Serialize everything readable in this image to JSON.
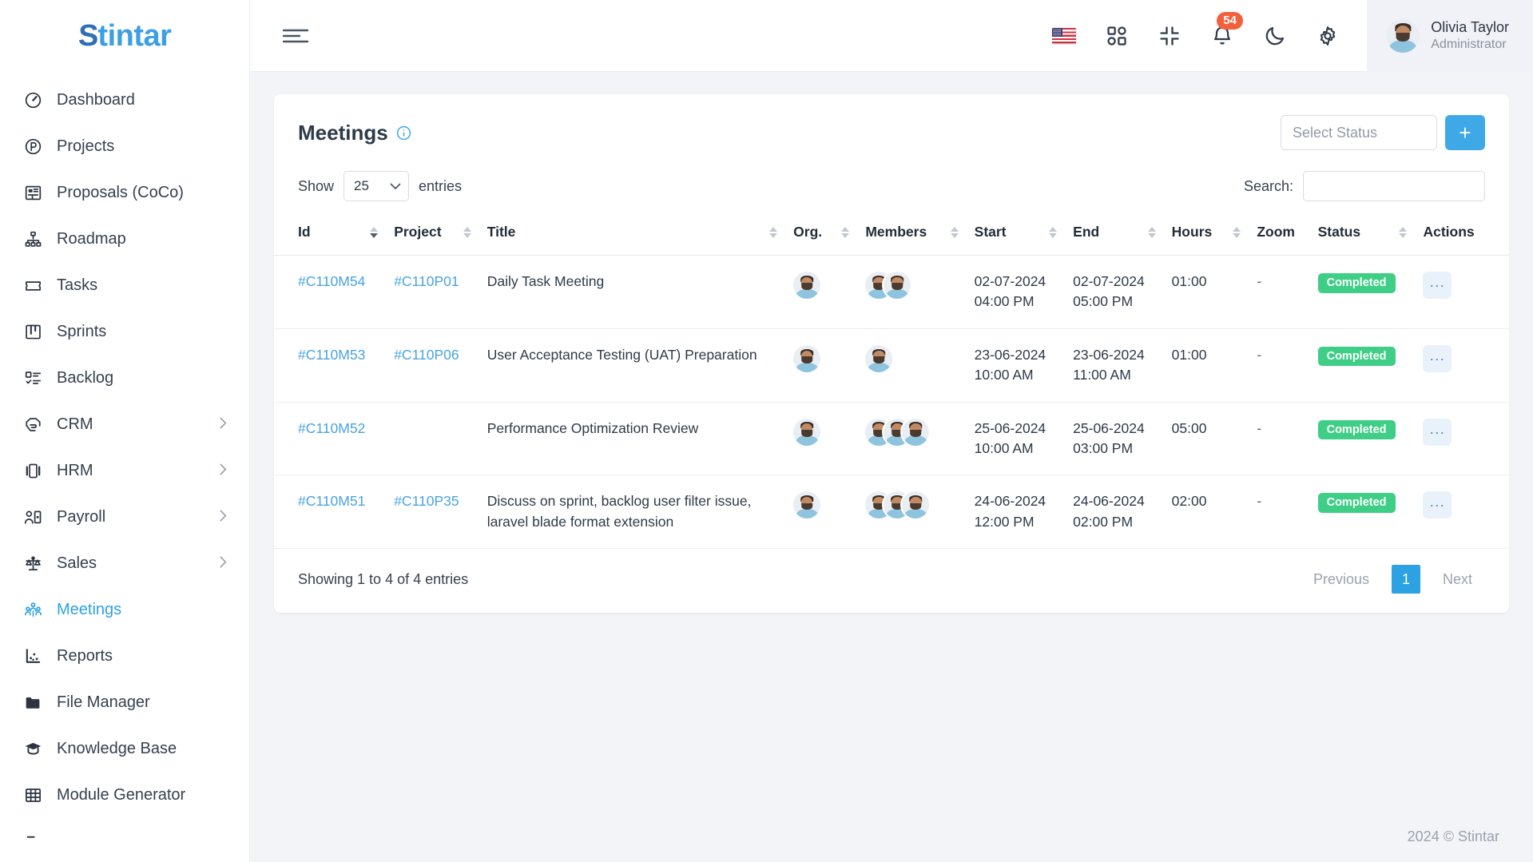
{
  "brand": {
    "name": "Stintar",
    "initial": "S",
    "rest": "tintar"
  },
  "sidebar": {
    "items": [
      {
        "label": "Dashboard",
        "icon": "gauge-icon",
        "active": false,
        "chevron": false
      },
      {
        "label": "Projects",
        "icon": "circle-p-icon",
        "active": false,
        "chevron": false
      },
      {
        "label": "Proposals (CoCo)",
        "icon": "layout-panel-icon",
        "active": false,
        "chevron": false
      },
      {
        "label": "Roadmap",
        "icon": "sitemap-icon",
        "active": false,
        "chevron": false
      },
      {
        "label": "Tasks",
        "icon": "ticket-icon",
        "active": false,
        "chevron": false
      },
      {
        "label": "Sprints",
        "icon": "kanban-icon",
        "active": false,
        "chevron": false
      },
      {
        "label": "Backlog",
        "icon": "checklist-icon",
        "active": false,
        "chevron": false
      },
      {
        "label": "CRM",
        "icon": "handshake-icon",
        "active": false,
        "chevron": true
      },
      {
        "label": "HRM",
        "icon": "id-card-icon",
        "active": false,
        "chevron": true
      },
      {
        "label": "Payroll",
        "icon": "user-money-icon",
        "active": false,
        "chevron": true
      },
      {
        "label": "Sales",
        "icon": "scales-icon",
        "active": false,
        "chevron": true
      },
      {
        "label": "Meetings",
        "icon": "people-group-icon",
        "active": true,
        "chevron": false
      },
      {
        "label": "Reports",
        "icon": "scatter-chart-icon",
        "active": false,
        "chevron": false
      },
      {
        "label": "File Manager",
        "icon": "folder-icon",
        "active": false,
        "chevron": false
      },
      {
        "label": "Knowledge Base",
        "icon": "graduation-cap-icon",
        "active": false,
        "chevron": false
      },
      {
        "label": "Module Generator",
        "icon": "grid-table-icon",
        "active": false,
        "chevron": false
      }
    ]
  },
  "topbar": {
    "menu_toggle": "hamburger-icon",
    "language_flag": "us-flag-icon",
    "apps": "apps-grid-icon",
    "fullscreen": "compress-icon",
    "notifications": "bell-icon",
    "notification_count": "54",
    "theme": "moon-icon",
    "settings": "gear-icon",
    "user": {
      "name": "Olivia Taylor",
      "role": "Administrator"
    }
  },
  "card": {
    "title": "Meetings",
    "info_icon": "info-circle-icon",
    "status_filter_placeholder": "Select Status",
    "add_label": "+"
  },
  "tools": {
    "show_label": "Show",
    "entries_label": "entries",
    "page_length": "25",
    "search_label": "Search:",
    "search_value": "",
    "search_placeholder": ""
  },
  "table": {
    "columns": [
      {
        "label": "Id",
        "sortable": true,
        "sort": "desc"
      },
      {
        "label": "Project",
        "sortable": true,
        "sort": "none"
      },
      {
        "label": "Title",
        "sortable": true,
        "sort": "none"
      },
      {
        "label": "Org.",
        "sortable": true,
        "sort": "none"
      },
      {
        "label": "Members",
        "sortable": true,
        "sort": "none"
      },
      {
        "label": "Start",
        "sortable": true,
        "sort": "none"
      },
      {
        "label": "End",
        "sortable": true,
        "sort": "none"
      },
      {
        "label": "Hours",
        "sortable": true,
        "sort": "none"
      },
      {
        "label": "Zoom",
        "sortable": false,
        "sort": "none"
      },
      {
        "label": "Status",
        "sortable": true,
        "sort": "none"
      },
      {
        "label": "Actions",
        "sortable": false,
        "sort": "none"
      }
    ],
    "rows": [
      {
        "id": "#C110M54",
        "project": "#C110P01",
        "title": "Daily Task Meeting",
        "org_count": 1,
        "member_count": 2,
        "start_date": "02-07-2024",
        "start_time": "04:00 PM",
        "end_date": "02-07-2024",
        "end_time": "05:00 PM",
        "hours": "01:00",
        "zoom": "-",
        "status": "Completed",
        "action": "..."
      },
      {
        "id": "#C110M53",
        "project": "#C110P06",
        "title": "User Acceptance Testing (UAT) Preparation",
        "org_count": 1,
        "member_count": 1,
        "start_date": "23-06-2024",
        "start_time": "10:00 AM",
        "end_date": "23-06-2024",
        "end_time": "11:00 AM",
        "hours": "01:00",
        "zoom": "-",
        "status": "Completed",
        "action": "..."
      },
      {
        "id": "#C110M52",
        "project": "",
        "title": "Performance Optimization Review",
        "org_count": 1,
        "member_count": 3,
        "start_date": "25-06-2024",
        "start_time": "10:00 AM",
        "end_date": "25-06-2024",
        "end_time": "03:00 PM",
        "hours": "05:00",
        "zoom": "-",
        "status": "Completed",
        "action": "..."
      },
      {
        "id": "#C110M51",
        "project": "#C110P35",
        "title": "Discuss on sprint, backlog user filter issue, laravel blade format extension",
        "org_count": 1,
        "member_count": 3,
        "start_date": "24-06-2024",
        "start_time": "12:00 PM",
        "end_date": "24-06-2024",
        "end_time": "02:00 PM",
        "hours": "02:00",
        "zoom": "-",
        "status": "Completed",
        "action": "..."
      }
    ]
  },
  "pagination": {
    "info": "Showing 1 to 4 of 4 entries",
    "previous": "Previous",
    "current_page": "1",
    "next": "Next"
  },
  "footer": {
    "copyright": "2024 © Stintar"
  },
  "colors": {
    "accent": "#3fa9e8",
    "accent_dark": "#2da2e3",
    "success": "#3fce86",
    "badge_red": "#f0613c",
    "link": "#4aa3e0",
    "page_bg": "#f3f4f7"
  }
}
